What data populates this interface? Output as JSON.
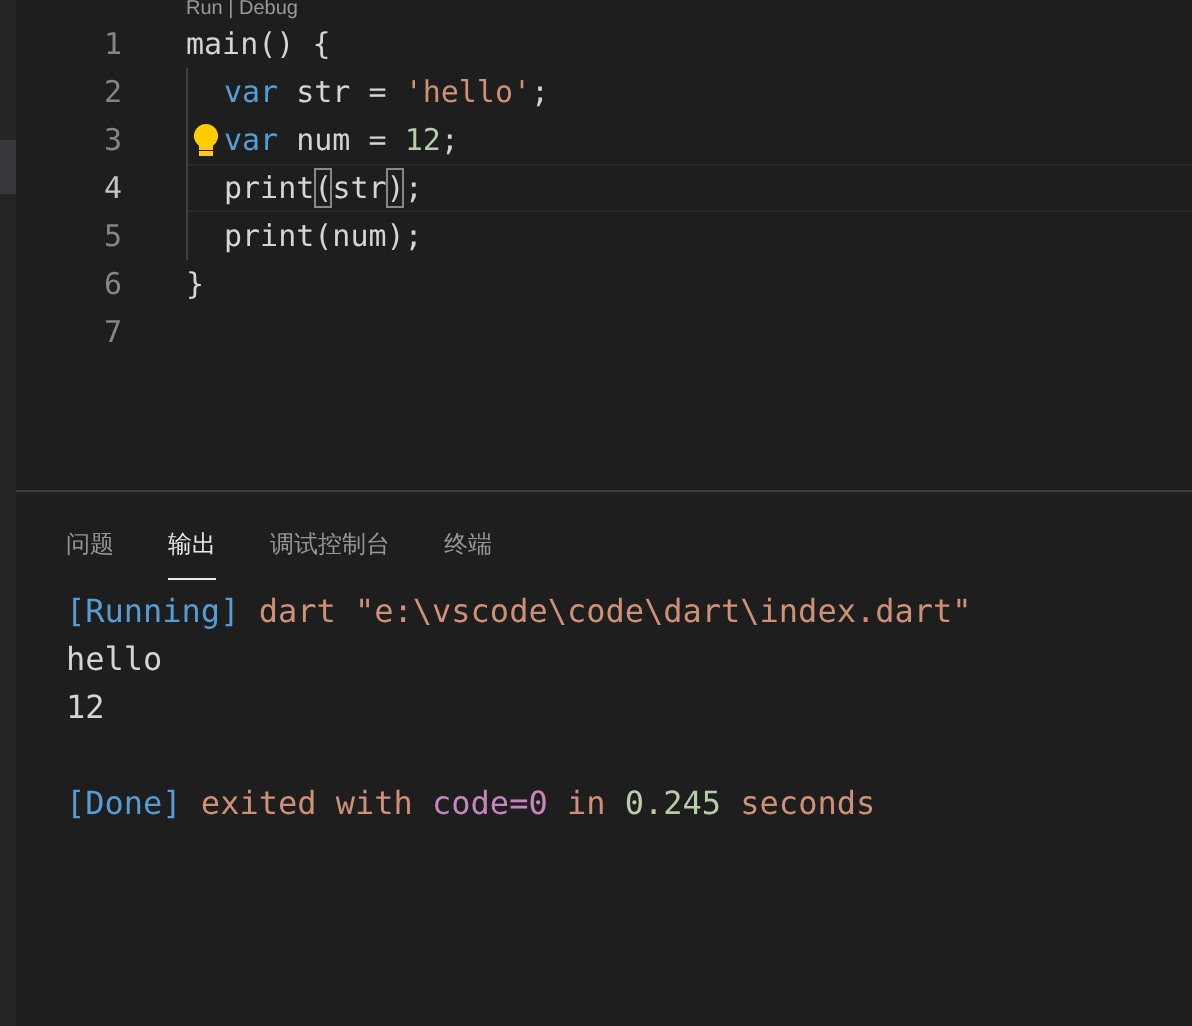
{
  "codelens": "Run | Debug",
  "editor": {
    "lines": [
      {
        "number": "1",
        "current": false,
        "hint": false,
        "indent": false,
        "tokens": [
          {
            "kind": "plain",
            "text": "main() {"
          }
        ]
      },
      {
        "number": "2",
        "current": false,
        "hint": false,
        "indent": true,
        "tokens": [
          {
            "kind": "keyword",
            "text": "var"
          },
          {
            "kind": "plain",
            "text": " str = "
          },
          {
            "kind": "string",
            "text": "'hello'"
          },
          {
            "kind": "plain",
            "text": ";"
          }
        ]
      },
      {
        "number": "3",
        "current": false,
        "hint": true,
        "indent": true,
        "tokens": [
          {
            "kind": "keyword",
            "text": "var"
          },
          {
            "kind": "plain",
            "text": " num = "
          },
          {
            "kind": "number",
            "text": "12"
          },
          {
            "kind": "plain",
            "text": ";"
          }
        ]
      },
      {
        "number": "4",
        "current": true,
        "hint": false,
        "indent": true,
        "tokens": [
          {
            "kind": "plain",
            "text": "print"
          },
          {
            "kind": "bracket",
            "text": "("
          },
          {
            "kind": "plain",
            "text": "str"
          },
          {
            "kind": "bracket",
            "text": ")"
          },
          {
            "kind": "plain",
            "text": ";"
          }
        ]
      },
      {
        "number": "5",
        "current": false,
        "hint": false,
        "indent": true,
        "tokens": [
          {
            "kind": "plain",
            "text": "print(num);"
          }
        ]
      },
      {
        "number": "6",
        "current": false,
        "hint": false,
        "indent": false,
        "tokens": [
          {
            "kind": "plain",
            "text": "}"
          }
        ]
      },
      {
        "number": "7",
        "current": false,
        "hint": false,
        "indent": false
      }
    ]
  },
  "panel": {
    "tabs": [
      {
        "label": "问题",
        "selected": false
      },
      {
        "label": "输出",
        "selected": true
      },
      {
        "label": "调试控制台",
        "selected": false
      },
      {
        "label": "终端",
        "selected": false
      }
    ],
    "output": [
      [
        {
          "kind": "tag",
          "text": "[Running]"
        },
        {
          "kind": "string",
          "text": " dart \"e:\\vscode\\code\\dart\\index.dart\""
        }
      ],
      [
        {
          "kind": "plain",
          "text": "hello"
        }
      ],
      [
        {
          "kind": "plain",
          "text": "12"
        }
      ],
      [
        {
          "kind": "gap"
        },
        {
          "kind": "tag",
          "text": "[Done]"
        },
        {
          "kind": "string",
          "text": " exited with "
        },
        {
          "kind": "purple",
          "text": "code=0"
        },
        {
          "kind": "string",
          "text": " in "
        },
        {
          "kind": "number",
          "text": "0.245"
        },
        {
          "kind": "string",
          "text": " seconds"
        }
      ]
    ]
  }
}
